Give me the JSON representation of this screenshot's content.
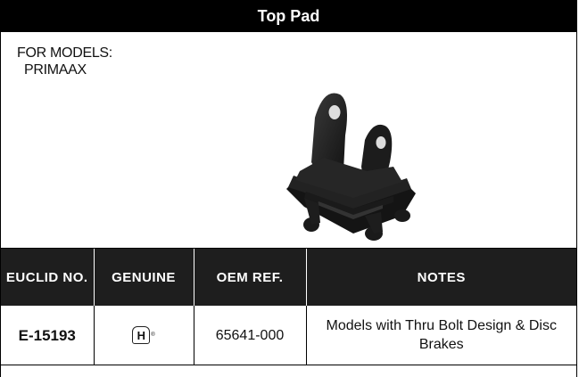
{
  "title": "Top Pad",
  "models": {
    "label": "FOR MODELS:",
    "items": [
      "PRIMAAX"
    ]
  },
  "image": {
    "subject": "top-pad-part-photo"
  },
  "table": {
    "headers": [
      "EUCLID NO.",
      "GENUINE",
      "OEM REF.",
      "NOTES"
    ],
    "rows": [
      {
        "euclid_no": "E-15193",
        "genuine": "H",
        "oem_ref": "65641-000",
        "notes": "Models with Thru Bolt Design & Disc Brakes"
      }
    ]
  }
}
